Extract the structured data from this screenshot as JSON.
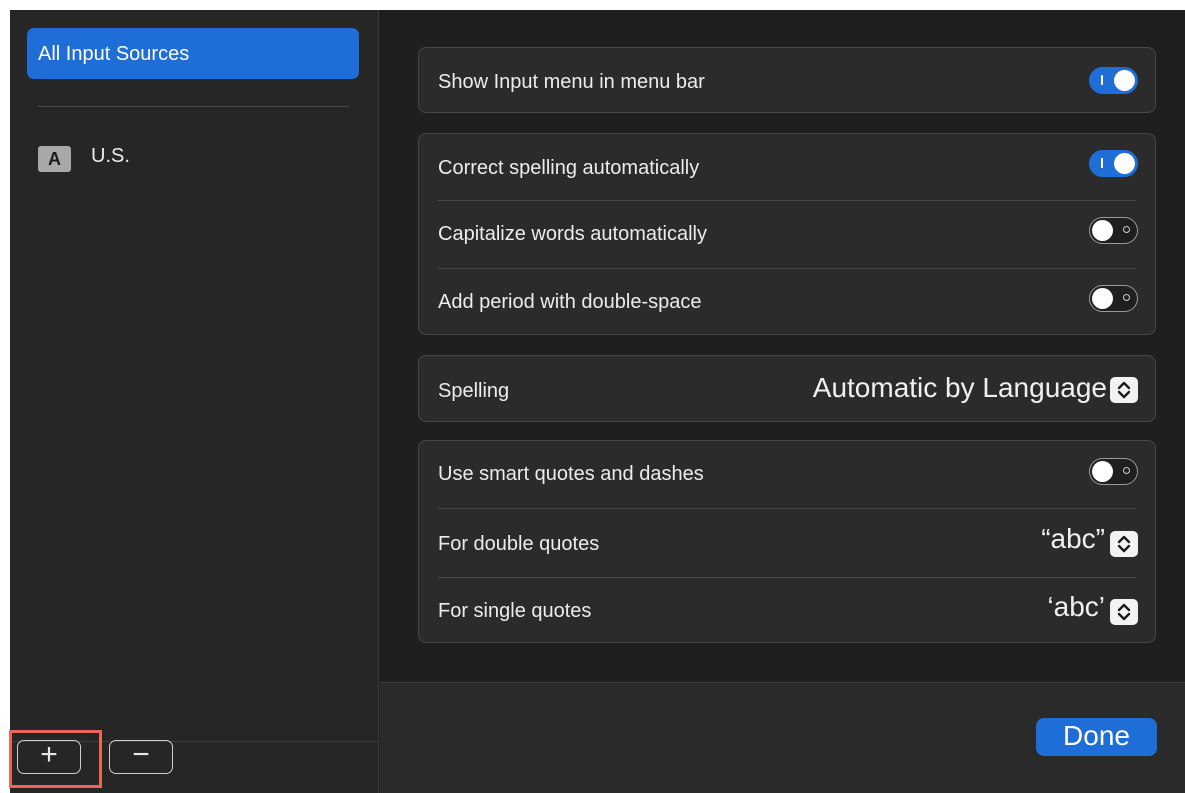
{
  "sidebar": {
    "selected_label": "All Input Sources",
    "sources": [
      {
        "badge": "A",
        "label": "U.S."
      }
    ],
    "add_symbol": "+",
    "remove_symbol": "−"
  },
  "settings": {
    "show_input_menu": {
      "label": "Show Input menu in menu bar",
      "on": true
    },
    "correct_spelling": {
      "label": "Correct spelling automatically",
      "on": true
    },
    "capitalize_words": {
      "label": "Capitalize words automatically",
      "on": false
    },
    "add_period": {
      "label": "Add period with double-space",
      "on": false
    },
    "spelling": {
      "label": "Spelling",
      "value": "Automatic by Language"
    },
    "smart_quotes": {
      "label": "Use smart quotes and dashes",
      "on": false
    },
    "double_quotes": {
      "label": "For double quotes",
      "value": "“abc”"
    },
    "single_quotes": {
      "label": "For single quotes",
      "value": "‘abc’"
    }
  },
  "footer": {
    "done_label": "Done"
  },
  "colors": {
    "accent": "#1f6ed8",
    "highlight": "#e8675b",
    "panel": "#2b2b2b",
    "background": "#1f1f1f"
  },
  "icons": {
    "toggle_on": "toggle-switch-on",
    "toggle_off": "toggle-switch-off",
    "popup": "chevron-up-down-icon"
  }
}
